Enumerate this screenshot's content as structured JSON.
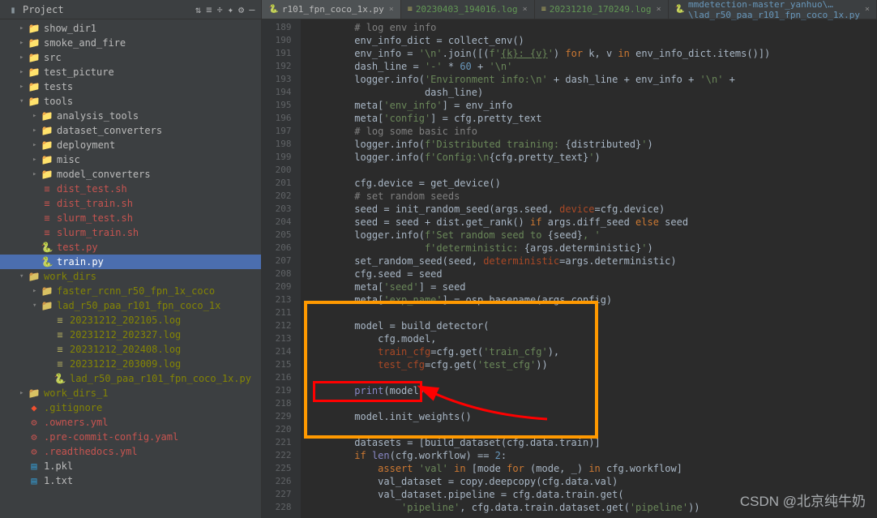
{
  "sidebar": {
    "title": "Project",
    "tools": [
      "⇅",
      "≡",
      "÷",
      "✦",
      "⚙",
      "—"
    ],
    "items": [
      {
        "depth": 1,
        "arrow": ">",
        "icon": "folder",
        "label": "show_dir1"
      },
      {
        "depth": 1,
        "arrow": ">",
        "icon": "folder",
        "label": "smoke_and_fire"
      },
      {
        "depth": 1,
        "arrow": ">",
        "icon": "folder",
        "label": "src"
      },
      {
        "depth": 1,
        "arrow": ">",
        "icon": "folder",
        "label": "test_picture"
      },
      {
        "depth": 1,
        "arrow": ">",
        "icon": "folder",
        "label": "tests"
      },
      {
        "depth": 1,
        "arrow": "v",
        "icon": "folder",
        "label": "tools"
      },
      {
        "depth": 2,
        "arrow": ">",
        "icon": "folder",
        "label": "analysis_tools"
      },
      {
        "depth": 2,
        "arrow": ">",
        "icon": "folder",
        "label": "dataset_converters"
      },
      {
        "depth": 2,
        "arrow": ">",
        "icon": "folder",
        "label": "deployment"
      },
      {
        "depth": 2,
        "arrow": ">",
        "icon": "folder",
        "label": "misc"
      },
      {
        "depth": 2,
        "arrow": ">",
        "icon": "folder",
        "label": "model_converters"
      },
      {
        "depth": 2,
        "arrow": "",
        "icon": "sh",
        "label": "dist_test.sh",
        "cls": "red-text"
      },
      {
        "depth": 2,
        "arrow": "",
        "icon": "sh",
        "label": "dist_train.sh",
        "cls": "red-text"
      },
      {
        "depth": 2,
        "arrow": "",
        "icon": "sh",
        "label": "slurm_test.sh",
        "cls": "red-text"
      },
      {
        "depth": 2,
        "arrow": "",
        "icon": "sh",
        "label": "slurm_train.sh",
        "cls": "red-text"
      },
      {
        "depth": 2,
        "arrow": "",
        "icon": "py",
        "label": "test.py",
        "cls": "red-text"
      },
      {
        "depth": 2,
        "arrow": "",
        "icon": "py",
        "label": "train.py",
        "selected": true
      },
      {
        "depth": 1,
        "arrow": "v",
        "icon": "folder-ex",
        "label": "work_dirs",
        "cls": "excluded-text"
      },
      {
        "depth": 2,
        "arrow": ">",
        "icon": "folder-ex",
        "label": "faster_rcnn_r50_fpn_1x_coco",
        "cls": "excluded-text"
      },
      {
        "depth": 2,
        "arrow": "v",
        "icon": "folder-ex",
        "label": "lad_r50_paa_r101_fpn_coco_1x",
        "cls": "excluded-text"
      },
      {
        "depth": 3,
        "arrow": "",
        "icon": "log",
        "label": "20231212_202105.log",
        "cls": "excluded-text"
      },
      {
        "depth": 3,
        "arrow": "",
        "icon": "log",
        "label": "20231212_202327.log",
        "cls": "excluded-text"
      },
      {
        "depth": 3,
        "arrow": "",
        "icon": "log",
        "label": "20231212_202408.log",
        "cls": "excluded-text"
      },
      {
        "depth": 3,
        "arrow": "",
        "icon": "log",
        "label": "20231212_203009.log",
        "cls": "excluded-text"
      },
      {
        "depth": 3,
        "arrow": "",
        "icon": "py",
        "label": "lad_r50_paa_r101_fpn_coco_1x.py",
        "cls": "excluded-text"
      },
      {
        "depth": 1,
        "arrow": ">",
        "icon": "folder-ex",
        "label": "work_dirs_1",
        "cls": "excluded-text"
      },
      {
        "depth": 1,
        "arrow": "",
        "icon": "git",
        "label": ".gitignore",
        "cls": "ignored-text"
      },
      {
        "depth": 1,
        "arrow": "",
        "icon": "yaml",
        "label": ".owners.yml",
        "cls": "red-text"
      },
      {
        "depth": 1,
        "arrow": "",
        "icon": "yaml",
        "label": ".pre-commit-config.yaml",
        "cls": "red-text"
      },
      {
        "depth": 1,
        "arrow": "",
        "icon": "yaml",
        "label": ".readthedocs.yml",
        "cls": "red-text"
      },
      {
        "depth": 1,
        "arrow": "",
        "icon": "pkl",
        "label": "1.pkl"
      },
      {
        "depth": 1,
        "arrow": "",
        "icon": "txt",
        "label": "1.txt"
      }
    ]
  },
  "tabs": [
    {
      "icon": "py",
      "label": "r101_fpn_coco_1x.py",
      "active": true,
      "color": ""
    },
    {
      "icon": "log",
      "label": "20230403_194016.log",
      "color": "green"
    },
    {
      "icon": "log",
      "label": "20231210_170249.log",
      "color": "green"
    },
    {
      "icon": "py",
      "label": "mmdetection-master_yanhuo\\…\\lad_r50_paa_r101_fpn_coco_1x.py",
      "color": "blue"
    }
  ],
  "lines": [
    {
      "n": 189,
      "html": "        <span class='cmt'># log env info</span>"
    },
    {
      "n": 190,
      "html": "        env_info_dict = collect_env()"
    },
    {
      "n": 191,
      "html": "        env_info = <span class='str'>'\\n'</span>.join([(<span class='str'>f'<u>{k}: {v}</u>'</span>) <span class='kw'>for</span> k, v <span class='kw'>in</span> env_info_dict.items()])"
    },
    {
      "n": 192,
      "html": "        dash_line = <span class='str'>'-'</span> * <span class='num'>60</span> + <span class='str'>'\\n'</span>"
    },
    {
      "n": 193,
      "html": "        logger.info(<span class='str'>'Environment info:\\n'</span> + dash_line + env_info + <span class='str'>'\\n'</span> +"
    },
    {
      "n": 194,
      "html": "                    dash_line)"
    },
    {
      "n": 195,
      "html": "        meta[<span class='str'>'env_info'</span>] = env_info"
    },
    {
      "n": 196,
      "html": "        meta[<span class='str'>'config'</span>] = cfg.pretty_text"
    },
    {
      "n": 197,
      "html": "        <span class='cmt'># log some basic info</span>"
    },
    {
      "n": 198,
      "html": "        logger.info(<span class='str'>f'Distributed training: </span>{distributed}<span class='str'>'</span>)"
    },
    {
      "n": 199,
      "html": "        logger.info(<span class='str'>f'Config:\\n</span>{cfg.pretty_text}<span class='str'>'</span>)"
    },
    {
      "n": 200,
      "html": ""
    },
    {
      "n": 201,
      "html": "        cfg.device = get_device()"
    },
    {
      "n": 202,
      "html": "        <span class='cmt'># set random seeds</span>"
    },
    {
      "n": 203,
      "html": "        seed = init_random_seed(args.seed, <span class='param'>device</span>=cfg.device)"
    },
    {
      "n": 204,
      "html": "        seed = seed + dist.get_rank() <span class='kw'>if</span> args.diff_seed <span class='kw'>else</span> seed"
    },
    {
      "n": 205,
      "html": "        logger.info(<span class='str'>f'Set random seed to </span>{seed}<span class='str'>, '</span>"
    },
    {
      "n": 206,
      "html": "                    <span class='str'>f'deterministic: </span>{args.deterministic}<span class='str'>'</span>)"
    },
    {
      "n": 207,
      "html": "        set_random_seed(seed, <span class='param'>deterministic</span>=args.deterministic)"
    },
    {
      "n": 208,
      "html": "        cfg.seed = seed"
    },
    {
      "n": 209,
      "html": "        meta[<span class='str'>'seed'</span>] = seed"
    },
    {
      "n": 213,
      "html": "        meta[<span class='str'>'exp_name'</span>] = osp.basename(args.config)"
    },
    {
      "n": 211,
      "html": ""
    },
    {
      "n": 212,
      "html": "        model = build_detector("
    },
    {
      "n": 213,
      "html": "            cfg.model,"
    },
    {
      "n": 214,
      "html": "            <span class='param'>train_cfg</span>=cfg.get(<span class='str'>'train_cfg'</span>),"
    },
    {
      "n": 215,
      "html": "            <span class='param'>test_cfg</span>=cfg.get(<span class='str'>'test_cfg'</span>))"
    },
    {
      "n": 216,
      "html": ""
    },
    {
      "n": 219,
      "html": "        <span class='builtin'>print</span>(model)"
    },
    {
      "n": 218,
      "html": ""
    },
    {
      "n": 229,
      "html": "        model.init_weights()"
    },
    {
      "n": 220,
      "html": ""
    },
    {
      "n": 221,
      "html": "        datasets = [build_dataset(cfg.data.train)]"
    },
    {
      "n": 222,
      "html": "        <span class='kw'>if</span> <span class='builtin'>len</span>(cfg.workflow) == <span class='num'>2</span>:"
    },
    {
      "n": 225,
      "html": "            <span class='kw'>assert</span> <span class='str'>'val'</span> <span class='kw'>in</span> [mode <span class='kw'>for</span> (mode, _) <span class='kw'>in</span> cfg.workflow]"
    },
    {
      "n": 226,
      "html": "            val_dataset = copy.deepcopy(cfg.data.val)"
    },
    {
      "n": 227,
      "html": "            val_dataset.pipeline = cfg.data.train.get("
    },
    {
      "n": 228,
      "html": "                <span class='str'>'pipeline'</span>, cfg.data.train.dataset.get(<span class='str'>'pipeline'</span>))"
    }
  ],
  "watermark": "CSDN @北京纯牛奶"
}
